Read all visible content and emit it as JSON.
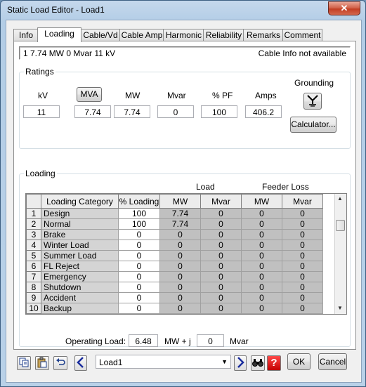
{
  "window": {
    "title": "Static Load Editor - Load1",
    "close_glyph": "✕"
  },
  "tabs": [
    {
      "label": "Info"
    },
    {
      "label": "Loading"
    },
    {
      "label": "Cable/Vd"
    },
    {
      "label": "Cable Amp"
    },
    {
      "label": "Harmonic"
    },
    {
      "label": "Reliability"
    },
    {
      "label": "Remarks"
    },
    {
      "label": "Comment"
    }
  ],
  "active_tab": "Loading",
  "infobar": {
    "summary": "1  7.74 MW   0 Mvar   11 kV",
    "cable_info": "Cable Info not available"
  },
  "ratings": {
    "legend": "Ratings",
    "kv_label": "kV",
    "kv_value": "11",
    "mva_button": "MVA",
    "mva_value": "7.74",
    "mw_label": "MW",
    "mw_value": "7.74",
    "mvar_label": "Mvar",
    "mvar_value": "0",
    "pf_label": "% PF",
    "pf_value": "100",
    "amps_label": "Amps",
    "amps_value": "406.2",
    "grounding_label": "Grounding",
    "grounding_icon": "wye-grounding-icon",
    "calculator_button": "Calculator..."
  },
  "loading": {
    "legend": "Loading",
    "load_group": "Load",
    "feeder_loss_group": "Feeder Loss",
    "columns": [
      "Loading Category",
      "% Loading",
      "MW",
      "Mvar",
      "MW",
      "Mvar"
    ],
    "rows": [
      {
        "n": "1",
        "category": "Design",
        "pct": "100",
        "mw": "7.74",
        "mvar": "0",
        "fl_mw": "0",
        "fl_mvar": "0"
      },
      {
        "n": "2",
        "category": "Normal",
        "pct": "100",
        "mw": "7.74",
        "mvar": "0",
        "fl_mw": "0",
        "fl_mvar": "0"
      },
      {
        "n": "3",
        "category": "Brake",
        "pct": "0",
        "mw": "0",
        "mvar": "0",
        "fl_mw": "0",
        "fl_mvar": "0"
      },
      {
        "n": "4",
        "category": "Winter Load",
        "pct": "0",
        "mw": "0",
        "mvar": "0",
        "fl_mw": "0",
        "fl_mvar": "0"
      },
      {
        "n": "5",
        "category": "Summer Load",
        "pct": "0",
        "mw": "0",
        "mvar": "0",
        "fl_mw": "0",
        "fl_mvar": "0"
      },
      {
        "n": "6",
        "category": "FL Reject",
        "pct": "0",
        "mw": "0",
        "mvar": "0",
        "fl_mw": "0",
        "fl_mvar": "0"
      },
      {
        "n": "7",
        "category": "Emergency",
        "pct": "0",
        "mw": "0",
        "mvar": "0",
        "fl_mw": "0",
        "fl_mvar": "0"
      },
      {
        "n": "8",
        "category": "Shutdown",
        "pct": "0",
        "mw": "0",
        "mvar": "0",
        "fl_mw": "0",
        "fl_mvar": "0"
      },
      {
        "n": "9",
        "category": "Accident",
        "pct": "0",
        "mw": "0",
        "mvar": "0",
        "fl_mw": "0",
        "fl_mvar": "0"
      },
      {
        "n": "10",
        "category": "Backup",
        "pct": "0",
        "mw": "0",
        "mvar": "0",
        "fl_mw": "0",
        "fl_mvar": "0"
      }
    ],
    "operating_load_label": "Operating Load:",
    "operating_mw": "6.48",
    "mw_j_label": "MW  + j",
    "operating_mvar": "0",
    "mvar_label": "Mvar"
  },
  "footer": {
    "element_select": "Load1",
    "ok_button": "OK",
    "cancel_button": "Cancel",
    "icons": [
      "copy-icon",
      "paste-icon",
      "undo-icon",
      "previous-icon",
      "next-icon",
      "find-icon",
      "help-icon"
    ]
  }
}
